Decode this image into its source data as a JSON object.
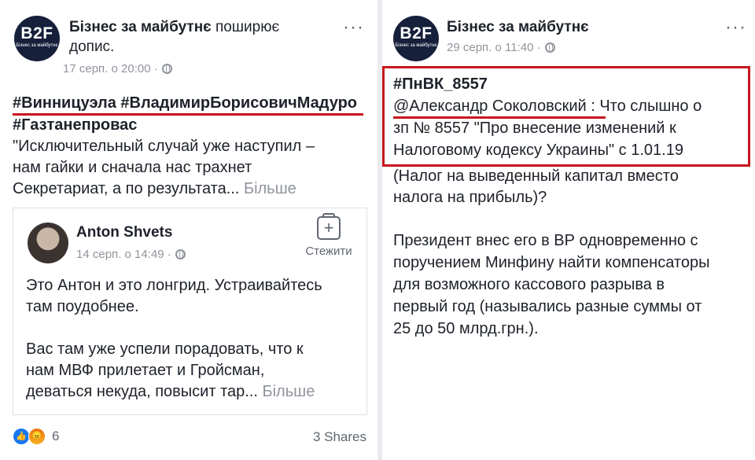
{
  "left_post": {
    "avatar_text": "B2F",
    "avatar_tagline": "Бізнес за майбутнє",
    "page_name": "Бізнес за майбутнє",
    "action_text": " поширює допис.",
    "timestamp": "17 серп. о 20:00 ·",
    "hashtags_line1": "#Винницуэла #ВладимирБорисовичМадуро",
    "hashtag_line2": "#Газтанепровас",
    "body_line1": "\"Исключительный случай уже наступил –",
    "body_line2": "нам гайки и сначала нас трахнет",
    "body_line3": "Секретариат, а по результата...",
    "more_label": "Більше",
    "shared": {
      "author": "Anton Shvets",
      "timestamp": "14 серп. о 14:49 ·",
      "save_label": "Стежити",
      "line1": "Это Антон и это лонгрид. Устраивайтесь",
      "line2": "там поудобнее.",
      "line3": "Вас там уже успели порадовать, что к",
      "line4": "нам МВФ прилетает и Гройсман,",
      "line5": "деваться некуда, повысит тар...",
      "more_label": "Більше"
    },
    "reaction_count": "6",
    "shares": "3 Shares"
  },
  "right_post": {
    "avatar_text": "B2F",
    "avatar_tagline": "Бізнес за майбутнє",
    "page_name": "Бізнес за майбутнє",
    "timestamp": "29 серп. о 11:40 ·",
    "hashtag": "#ПнВК_8557",
    "line1": "@Александр Соколовский : Что слышно о",
    "line2": "зп № 8557 \"Про внесение изменений к",
    "line3": "Налоговому кодексу Украины\" с 1.01.19",
    "line4": "(Налог на выведенный капитал вместо",
    "line5": "налога на прибыль)?",
    "line6": "Президент внес его в ВР одновременно с",
    "line7": "поручением Минфину найти компенсаторы",
    "line8": "для возможного кассового разрыва в",
    "line9": "первый год (назывались разные суммы от",
    "line10": "25 до 50 млрд.грн.)."
  },
  "colors": {
    "highlight": "#c8161d",
    "avatar_bg": "#16203b",
    "meta_gray": "#90949c"
  },
  "icons": [
    "globe-icon",
    "more-options-icon",
    "save-icon",
    "like-icon",
    "angry-icon"
  ]
}
